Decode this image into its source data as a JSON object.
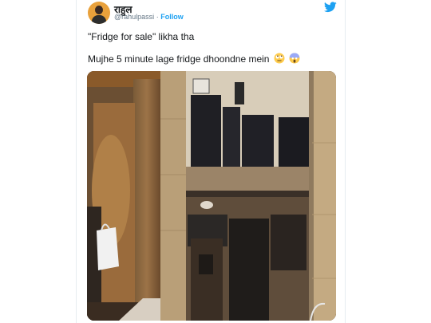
{
  "tweet": {
    "display_name": "राहुल",
    "handle": "@rahulpassi",
    "separator": "·",
    "follow_label": "Follow",
    "text_line1": "\"Fridge for sale\" likha tha",
    "text_line2": "Mujhe 5 minute lage fridge dhoondne mein"
  },
  "icons": {
    "platform": "twitter-bird-icon",
    "emoji1": "rolling-eyes-emoji",
    "emoji2": "screaming-face-emoji"
  },
  "colors": {
    "accent": "#1da1f2",
    "text": "#14171a",
    "muted": "#657786"
  }
}
